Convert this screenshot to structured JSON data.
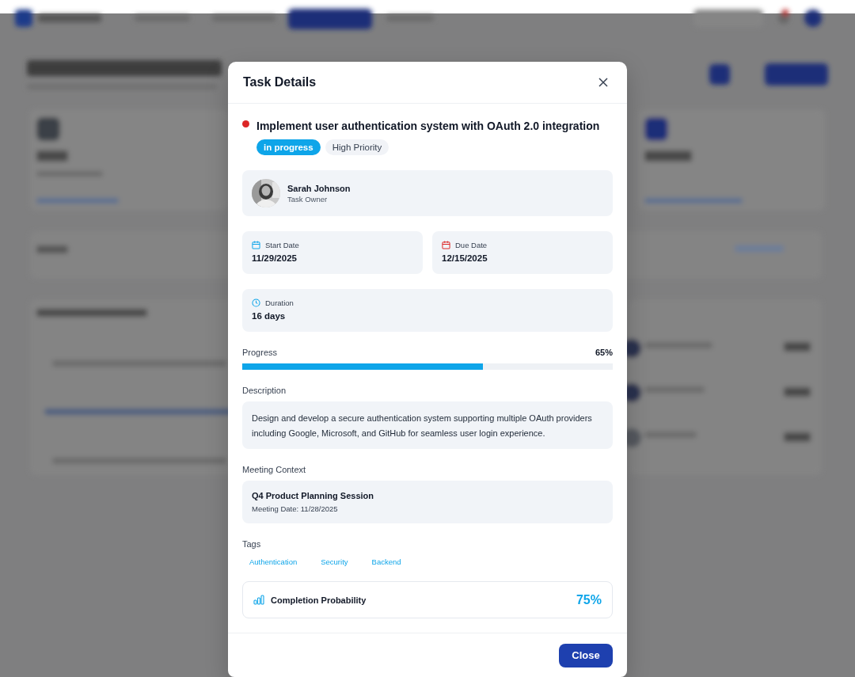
{
  "modal": {
    "title": "Task Details",
    "task": {
      "title": "Implement user authentication system with OAuth 2.0 integration",
      "status": "in progress",
      "priority": "High Priority"
    },
    "owner": {
      "name": "Sarah Johnson",
      "role": "Task Owner"
    },
    "dates": [
      {
        "kind": "start",
        "label": "Start Date",
        "value": "11/29/2025"
      },
      {
        "kind": "due",
        "label": "Due Date",
        "value": "12/15/2025"
      }
    ],
    "duration": {
      "label": "Duration",
      "value": "16 days"
    },
    "progress": {
      "label": "Progress",
      "reading": "65%",
      "level": 0.65
    },
    "description": {
      "label": "Description",
      "text": "Design and develop a secure authentication system supporting multiple OAuth providers including Google, Microsoft, and GitHub for seamless user login experience."
    },
    "meeting": {
      "label": "Meeting Context",
      "title": "Q4 Product Planning Session",
      "date": "Meeting Date: 11/28/2025"
    },
    "tags": {
      "label": "Tags",
      "items": [
        "Authentication",
        "Security",
        "Backend"
      ]
    },
    "probability": {
      "label": "Completion Probability",
      "value": "75%"
    },
    "buttons": [
      "Close"
    ]
  }
}
